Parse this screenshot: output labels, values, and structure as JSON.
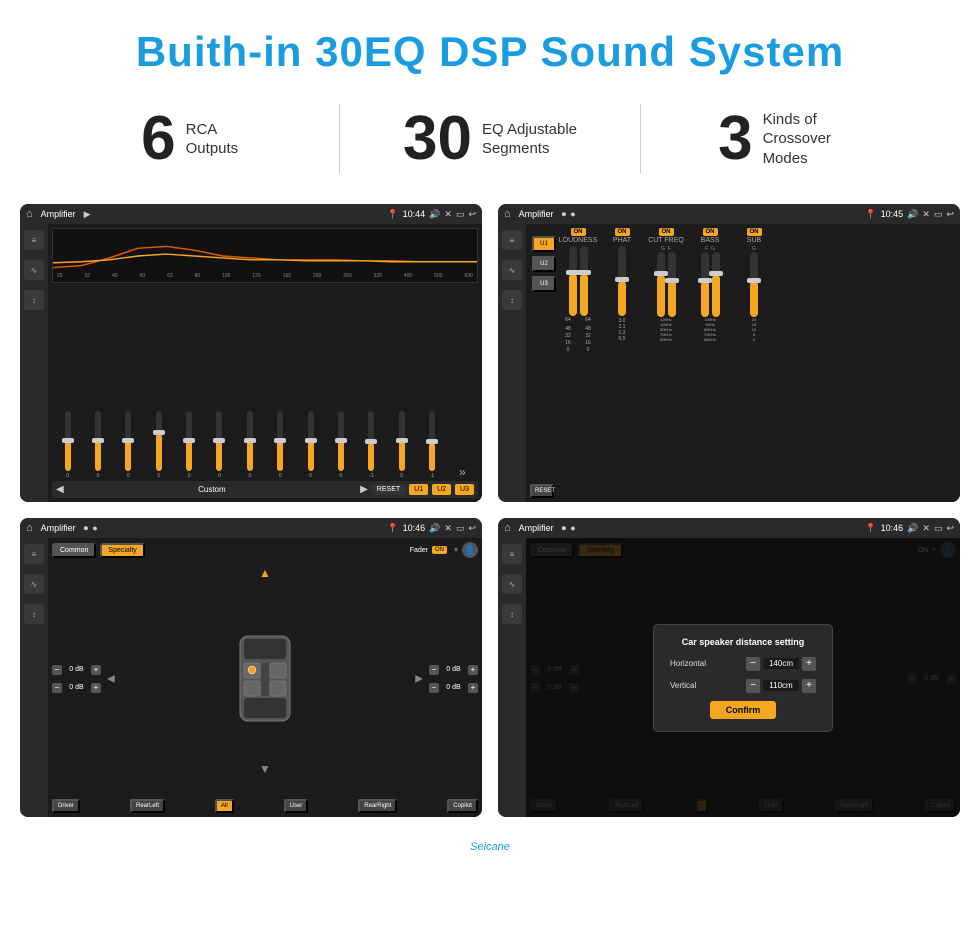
{
  "header": {
    "title": "Buith-in 30EQ DSP Sound System"
  },
  "stats": [
    {
      "number": "6",
      "label": "RCA\nOutputs"
    },
    {
      "number": "30",
      "label": "EQ Adjustable\nSegments"
    },
    {
      "number": "3",
      "label": "Kinds of\nCrossover Modes"
    }
  ],
  "screen1": {
    "title": "Amplifier",
    "time": "10:44",
    "eq_freqs": [
      "25",
      "32",
      "40",
      "50",
      "63",
      "80",
      "100",
      "125",
      "160",
      "200",
      "250",
      "320",
      "400",
      "500",
      "630"
    ],
    "eq_values": [
      "0",
      "0",
      "0",
      "5",
      "0",
      "0",
      "0",
      "0",
      "0",
      "0",
      "-1",
      "0",
      "-1"
    ],
    "bottom_label": "Custom",
    "buttons": [
      "RESET",
      "U1",
      "U2",
      "U3"
    ]
  },
  "screen2": {
    "title": "Amplifier",
    "time": "10:45",
    "channels": [
      "LOUDNESS",
      "PHAT",
      "CUT FREQ",
      "BASS",
      "SUB"
    ],
    "channel_notes": [
      "",
      "",
      "G  F",
      "F  G",
      "G"
    ],
    "reset_label": "RESET"
  },
  "screen3": {
    "title": "Amplifier",
    "time": "10:46",
    "tabs": [
      "Common",
      "Specialty"
    ],
    "fader_label": "Fader",
    "fader_on": "ON",
    "speaker_positions": [
      "Driver",
      "RearLeft",
      "All",
      "User",
      "RearRight",
      "Copilot"
    ],
    "db_values": [
      "0 dB",
      "0 dB",
      "0 dB",
      "0 dB"
    ]
  },
  "screen4": {
    "title": "Amplifier",
    "time": "10:46",
    "tabs": [
      "Common",
      "Specialty"
    ],
    "dialog_title": "Car speaker distance setting",
    "horizontal_label": "Horizontal",
    "horizontal_value": "140cm",
    "vertical_label": "Vertical",
    "vertical_value": "110cm",
    "confirm_label": "Confirm",
    "db_values": [
      "0 dB",
      "0 dB"
    ],
    "speaker_positions": [
      "Driver",
      "RearLeft",
      "User",
      "RearRight",
      "Copilot"
    ]
  },
  "watermark": "Seicane"
}
